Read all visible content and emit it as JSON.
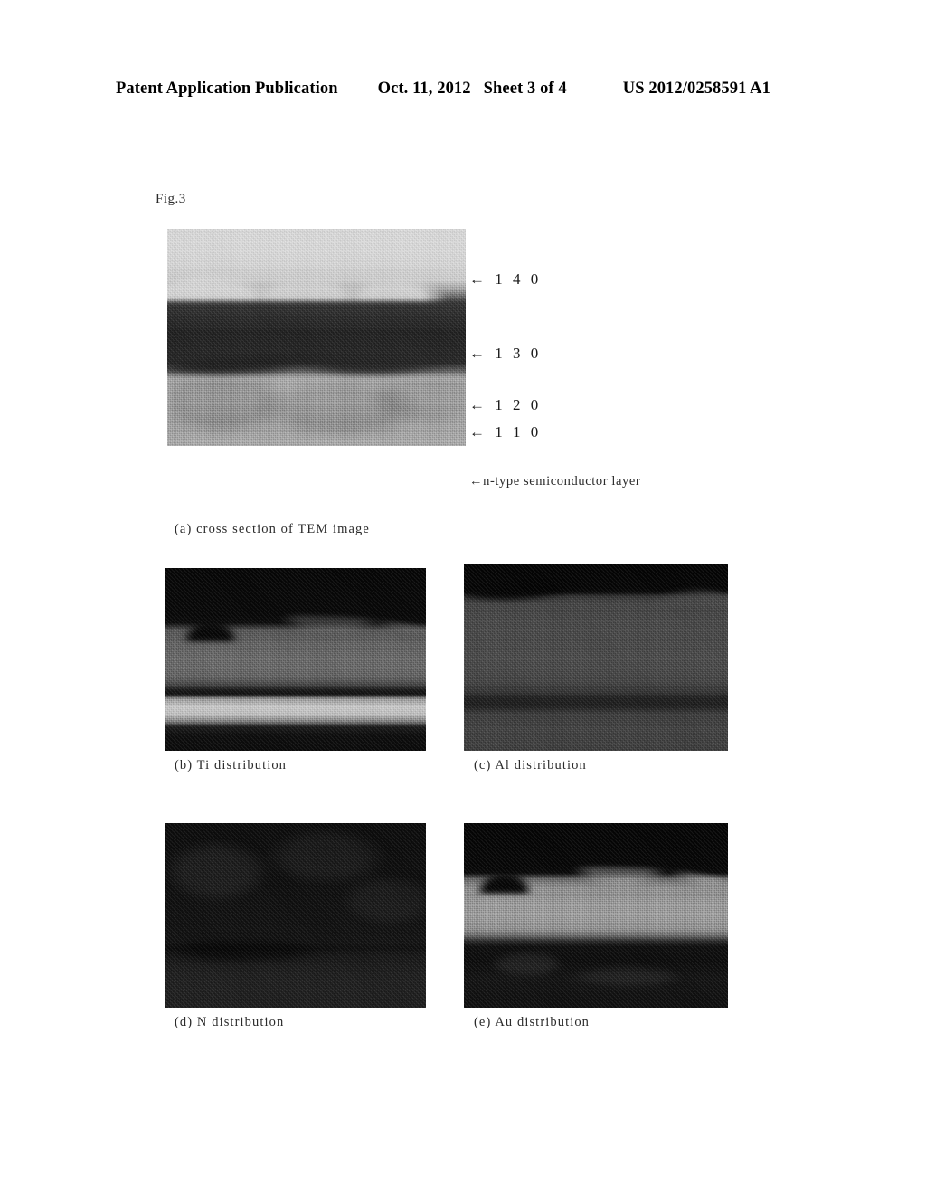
{
  "header": {
    "publication": "Patent Application Publication",
    "date": "Oct. 11, 2012",
    "sheet": "Sheet 3 of 4",
    "document_number": "US 2012/0258591 A1"
  },
  "figure": {
    "label": "Fig.3",
    "reference_labels": [
      {
        "id": "ref-140",
        "text": "← 1 4 0"
      },
      {
        "id": "ref-130",
        "text": "← 1 3 0"
      },
      {
        "id": "ref-120",
        "text": "← 1 2 0"
      },
      {
        "id": "ref-110",
        "text": "← 1 1 0"
      }
    ],
    "substrate_note": "←n-type semiconductor layer",
    "panels": [
      {
        "id": "a",
        "caption": "(a) cross section of TEM image"
      },
      {
        "id": "b",
        "caption": "(b) Ti distribution"
      },
      {
        "id": "c",
        "caption": "(c) Al distribution"
      },
      {
        "id": "d",
        "caption": "(d) N distribution"
      },
      {
        "id": "e",
        "caption": "(e) Au distribution"
      }
    ]
  },
  "colors": {
    "page_background": "#ffffff",
    "ink": "#000000",
    "halftone_ink": "#2b2b2b"
  }
}
